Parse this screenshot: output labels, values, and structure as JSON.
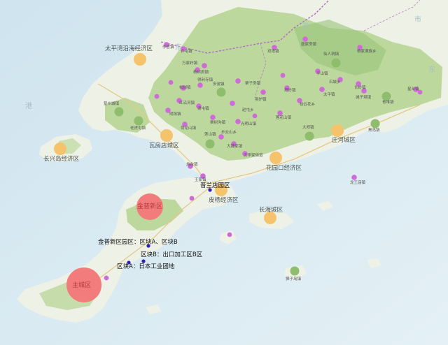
{
  "colors": {
    "sea": "#d7e9f1",
    "land_low": "#eef1e6",
    "land_green": "#bcd89c",
    "land_green_dark": "#98c57a",
    "major_zone": "#f27c7c",
    "development_zone": "#f5c36b",
    "town": "#8ebd6e",
    "village": "#d06ad8",
    "park_marker": "#2e1fb0",
    "boundary": "#b070c0"
  },
  "circle_types": {
    "major": "major-zone-circle",
    "dev": "development-zone-circle",
    "town": "town-circle",
    "village": "village-dot"
  },
  "zones": [
    {
      "label": "太平湾沿海经济区",
      "kind": "dev"
    },
    {
      "label": "长兴岛经济区",
      "kind": "dev"
    },
    {
      "label": "瓦房店城区",
      "kind": "dev"
    },
    {
      "label": "庄河城区",
      "kind": "dev"
    },
    {
      "label": "花园口经济区",
      "kind": "dev"
    },
    {
      "label": "皮杨经济区",
      "kind": "dev"
    },
    {
      "label": "长海城区",
      "kind": "dev"
    },
    {
      "label": "金普新区",
      "kind": "major"
    },
    {
      "label": "主城区",
      "kind": "major"
    }
  ],
  "towns": [
    {
      "label": "复州城镇"
    },
    {
      "label": "老虎屯镇"
    },
    {
      "label": "安波镇"
    },
    {
      "label": "仙人洞镇"
    },
    {
      "label": "莲山镇"
    },
    {
      "label": "青堆镇"
    },
    {
      "label": "黑岛镇"
    },
    {
      "label": "大郑镇"
    },
    {
      "label": "獐子岛镇"
    }
  ],
  "village_labels": [
    "李官镇",
    "许屯镇",
    "万家岭镇",
    "杨树房镇",
    "松树镇",
    "得利寺镇",
    "红沿河镇",
    "谢屯镇",
    "赵屯乡",
    "栗子房镇",
    "吴炉镇",
    "塔岭镇",
    "明阳镇",
    "荷花山镇",
    "步云山乡",
    "光明山镇",
    "桂云花乡",
    "蓉花山镇",
    "平山镇",
    "石城乡",
    "长岭镇",
    "星台镇",
    "城子坦镇",
    "杨家满族乡",
    "大魏家镇",
    "大李家街道",
    "炮台镇",
    "王家镇",
    "双塔镇",
    "太平镇",
    "唐家房镇",
    "龙王庙镇",
    "栗树沟镇"
  ],
  "villages_unlabeled_count": 8,
  "parks": [
    {
      "label": "普兰店园区"
    },
    {
      "label": "金普新区园区：区块A、区块B"
    },
    {
      "label": "区块B：出口加工区B区"
    },
    {
      "label": "区块A：日本工业团地"
    }
  ],
  "basemap_labels": [
    "东",
    "港",
    "丹",
    "东",
    "市"
  ]
}
